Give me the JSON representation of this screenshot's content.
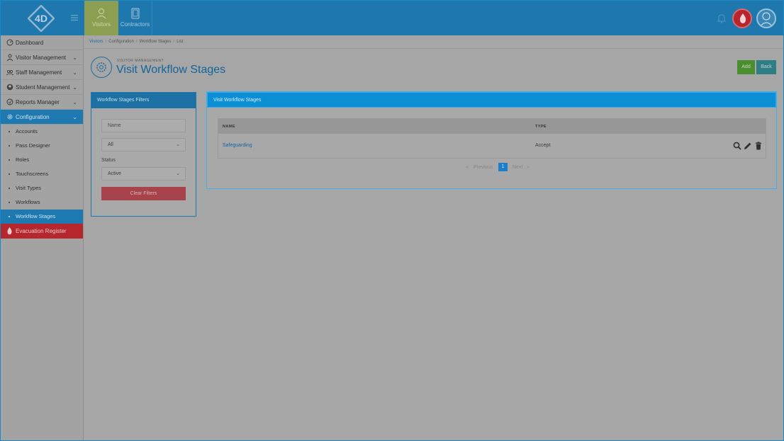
{
  "topbar": {
    "logo_text": "4D",
    "tabs": [
      {
        "label": "Visitors",
        "active": true
      },
      {
        "label": "Contractors",
        "active": false
      }
    ]
  },
  "sidebar": {
    "items": [
      {
        "label": "Dashboard",
        "icon": "dashboard-icon",
        "has_chevron": false
      },
      {
        "label": "Visitor Management",
        "icon": "visitor-icon",
        "has_chevron": true
      },
      {
        "label": "Staff Management",
        "icon": "staff-icon",
        "has_chevron": true
      },
      {
        "label": "Student Management",
        "icon": "student-icon",
        "has_chevron": true
      },
      {
        "label": "Reports Manager",
        "icon": "reports-icon",
        "has_chevron": true
      },
      {
        "label": "Configuration",
        "icon": "gear-icon",
        "has_chevron": true,
        "active": true
      }
    ],
    "sub_items": [
      "Accounts",
      "Pass Designer",
      "Roles",
      "Touchscreens",
      "Visit Types",
      "Workflows",
      "Workflow Stages"
    ],
    "active_sub": "Workflow Stages",
    "evacuation": "Evacuation Register"
  },
  "breadcrumb": {
    "items": [
      "Visitors",
      "Configuration",
      "Workflow Stages",
      "List"
    ]
  },
  "header": {
    "subtitle": "VISITOR MANAGEMENT",
    "title": "Visit Workflow Stages",
    "add_label": "Add",
    "back_label": "Back"
  },
  "filters": {
    "title": "Workflow Stages Filters",
    "name_placeholder": "Name",
    "type_value": "All",
    "status_label": "Status",
    "status_value": "Active",
    "clear_label": "Clear Filters"
  },
  "main": {
    "title": "Visit Workflow Stages",
    "columns": [
      "NAME",
      "TYPE"
    ],
    "rows": [
      {
        "name": "Safeguarding",
        "type": "Accept"
      }
    ],
    "pager": {
      "prev": "Previous",
      "current": "1",
      "next": "Next",
      "prev_arrow": "«",
      "next_arrow": "»"
    }
  },
  "colors": {
    "topbar": "#1e78ad",
    "accent": "#0d8fd6",
    "add": "#4a8f2f",
    "back": "#2f7e86",
    "danger": "#b5262d"
  }
}
